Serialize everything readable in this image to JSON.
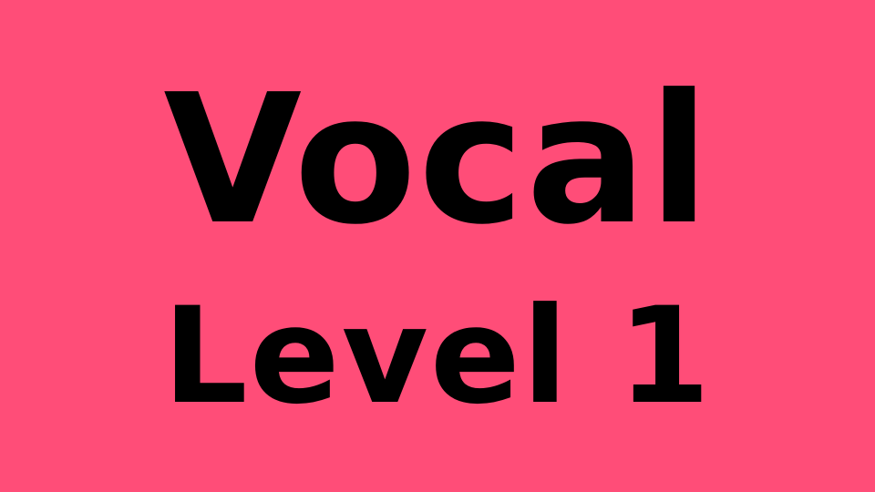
{
  "slide": {
    "background_color": "#FF4D78",
    "text_color": "#000000",
    "title_line_1": "Vocal",
    "title_line_2": "Level 1"
  }
}
